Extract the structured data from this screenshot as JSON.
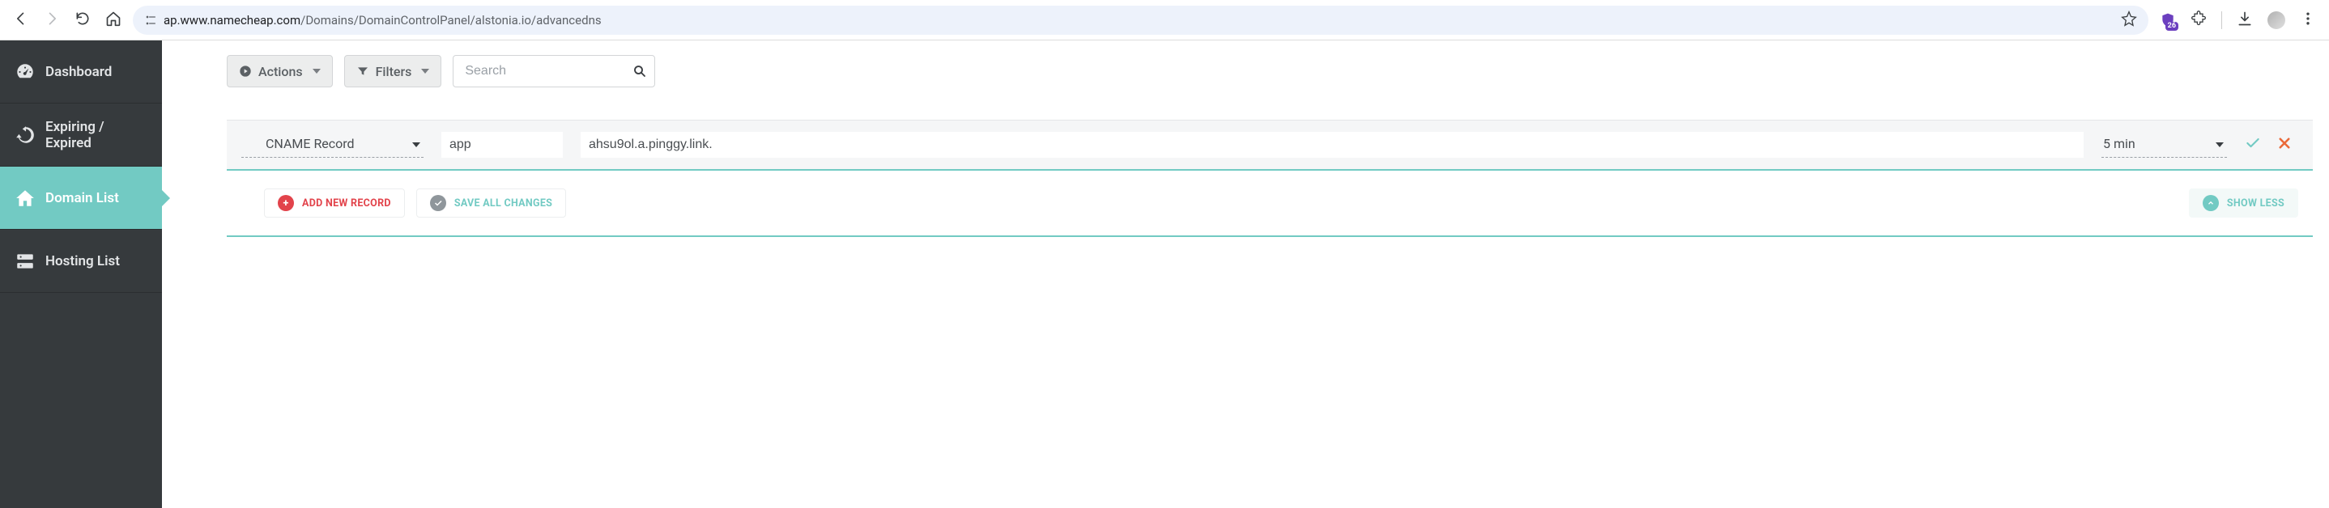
{
  "browser": {
    "url_host": "ap.www.namecheap.com",
    "url_path": "/Domains/DomainControlPanel/alstonia.io/advancedns",
    "ext_badge_count": "26"
  },
  "sidebar": {
    "items": [
      {
        "label": "Dashboard"
      },
      {
        "label": "Expiring / Expired"
      },
      {
        "label": "Domain List"
      },
      {
        "label": "Hosting List"
      }
    ]
  },
  "toolbar": {
    "actions_label": "Actions",
    "filters_label": "Filters",
    "search_placeholder": "Search"
  },
  "record": {
    "type": "CNAME Record",
    "host": "app",
    "target": "ahsu9ol.a.pinggy.link.",
    "ttl": "5 min"
  },
  "footer": {
    "add_label": "ADD NEW RECORD",
    "save_label": "SAVE ALL CHANGES",
    "showless_label": "SHOW LESS"
  }
}
